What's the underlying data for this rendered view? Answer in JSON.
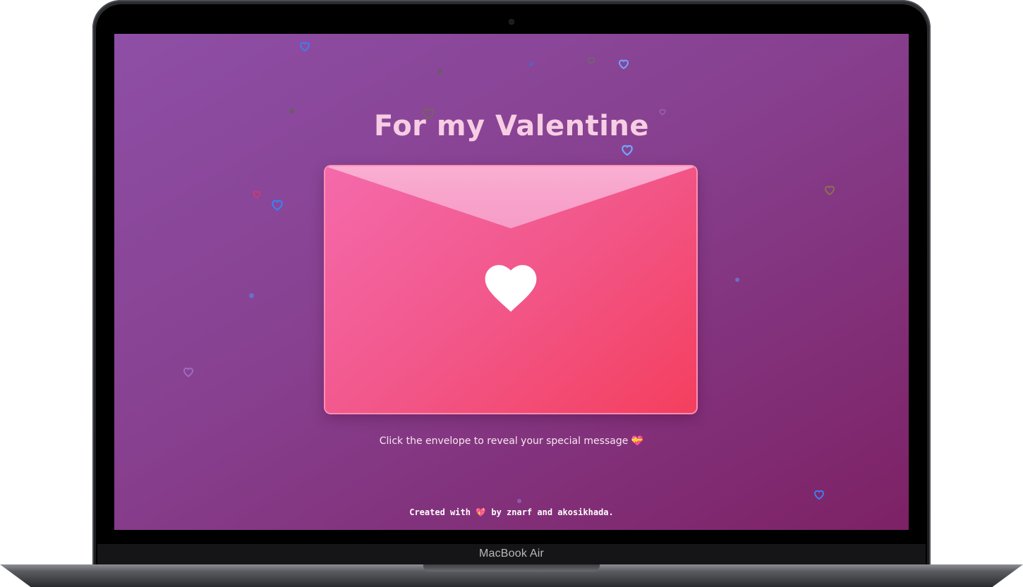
{
  "device": {
    "model_label": "MacBook Air"
  },
  "page": {
    "title": "For my Valentine",
    "hint_text": "Click the envelope to reveal your special message",
    "hint_emoji": "💝",
    "footer_prefix": "Created with",
    "footer_emoji": "💖",
    "footer_suffix": "by znarf and akosikhada."
  },
  "colors": {
    "background_start": "#8e4fa6",
    "background_end": "#7d2165",
    "title": "#f7cde3",
    "envelope_start": "#f46aab",
    "envelope_end": "#f43f5e",
    "envelope_flap": "#f8a6cc",
    "heart": "#ffffff"
  },
  "icons": {
    "envelope_heart": "heart-icon",
    "floating_decorations": "heart-icon"
  }
}
